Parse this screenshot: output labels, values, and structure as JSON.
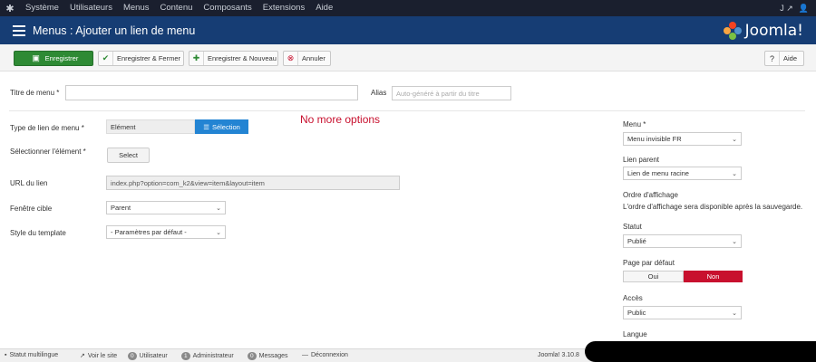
{
  "topnav": {
    "items": [
      "Système",
      "Utilisateurs",
      "Menus",
      "Contenu",
      "Composants",
      "Extensions",
      "Aide"
    ]
  },
  "header": {
    "title": "Menus : Ajouter un lien de menu",
    "brand": "Joomla!"
  },
  "toolbar": {
    "save_label": "Enregistrer",
    "save_close_label": "Enregistrer & Fermer",
    "save_new_label": "Enregistrer & Nouveau",
    "cancel_label": "Annuler",
    "help_label": "Aide"
  },
  "form": {
    "title_label": "Titre de menu *",
    "title_value": "",
    "alias_label": "Alias",
    "alias_placeholder": "Auto-généré à partir du titre",
    "note": "No more options",
    "type_label": "Type de lien de menu *",
    "type_value": "Elément",
    "selection_label": "Sélection",
    "select_item_label": "Sélectionner l'élément *",
    "select_button": "Select",
    "url_label": "URL du lien",
    "url_value": "index.php?option=com_k2&view=item&layout=item",
    "target_label": "Fenêtre cible",
    "target_value": "Parent",
    "style_label": "Style du template",
    "style_value": "- Paramètres par défaut -"
  },
  "sidebar": {
    "menu_label": "Menu *",
    "menu_value": "Menu invisible FR",
    "parent_label": "Lien parent",
    "parent_value": "Lien de menu racine",
    "order_label": "Ordre d'affichage",
    "order_text": "L'ordre d'affichage sera disponible après la sauvegarde.",
    "status_label": "Statut",
    "status_value": "Publié",
    "default_label": "Page par défaut",
    "default_no": "Oui",
    "default_yes": "Non",
    "access_label": "Accès",
    "access_value": "Public",
    "language_label": "Langue"
  },
  "statusbar": {
    "multilang": "Statut multilingue",
    "view_site": "Voir le site",
    "users_count": "0",
    "users_label": "Utilisateur",
    "admins_count": "1",
    "admins_label": "Administrateur",
    "messages_count": "0",
    "messages_label": "Messages",
    "logout": "Déconnexion",
    "version": "Joomla! 3.10.8"
  },
  "colors": {
    "header_bg": "#163d74",
    "topnav_bg": "#1a1f2e",
    "save_green": "#2e8a34",
    "selection_blue": "#2384d3",
    "toggle_red": "#c8102e"
  },
  "icons": [
    "joomla-icon",
    "external-link-icon",
    "user-icon",
    "list-icon",
    "save-icon",
    "check-icon",
    "plus-icon",
    "cancel-icon",
    "help-icon",
    "list-icon",
    "eye-icon"
  ]
}
